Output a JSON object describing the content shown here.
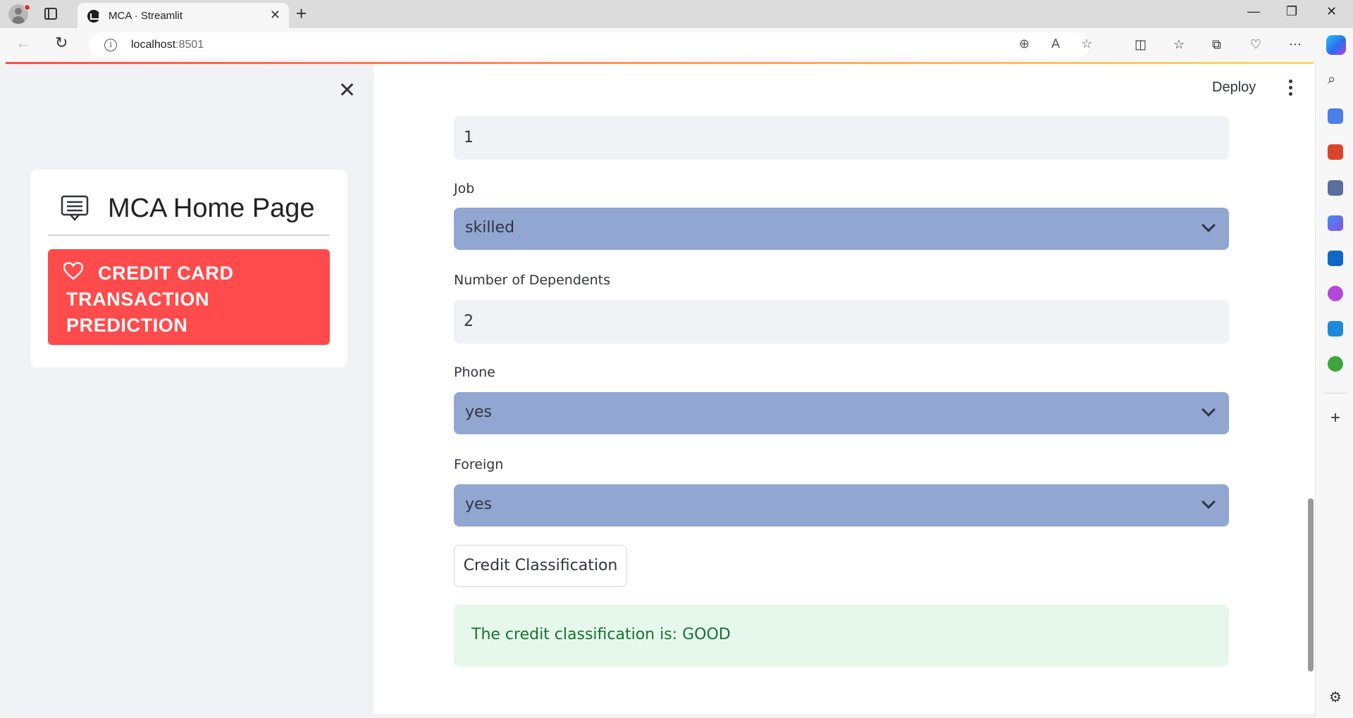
{
  "browser": {
    "tab_title": "MCA · Streamlit",
    "url_host": "localhost",
    "url_port": ":8501"
  },
  "sidebar": {
    "menu_title": "MCA Home Page",
    "menu_item_label": "CREDIT CARD TRANSACTION PREDICTION"
  },
  "header": {
    "deploy_label": "Deploy"
  },
  "form": {
    "top_input_value": "1",
    "job_label": "Job",
    "job_value": "skilled",
    "dependents_label": "Number of Dependents",
    "dependents_value": "2",
    "phone_label": "Phone",
    "phone_value": "yes",
    "foreign_label": "Foreign",
    "foreign_value": "yes",
    "submit_label": "Credit Classification",
    "result_text": "The credit classification is: GOOD"
  },
  "colors": {
    "primary": "#ff4b4b",
    "select_bg": "#91a7d1",
    "success_bg": "#e6f8ec",
    "success_text": "#177233"
  }
}
